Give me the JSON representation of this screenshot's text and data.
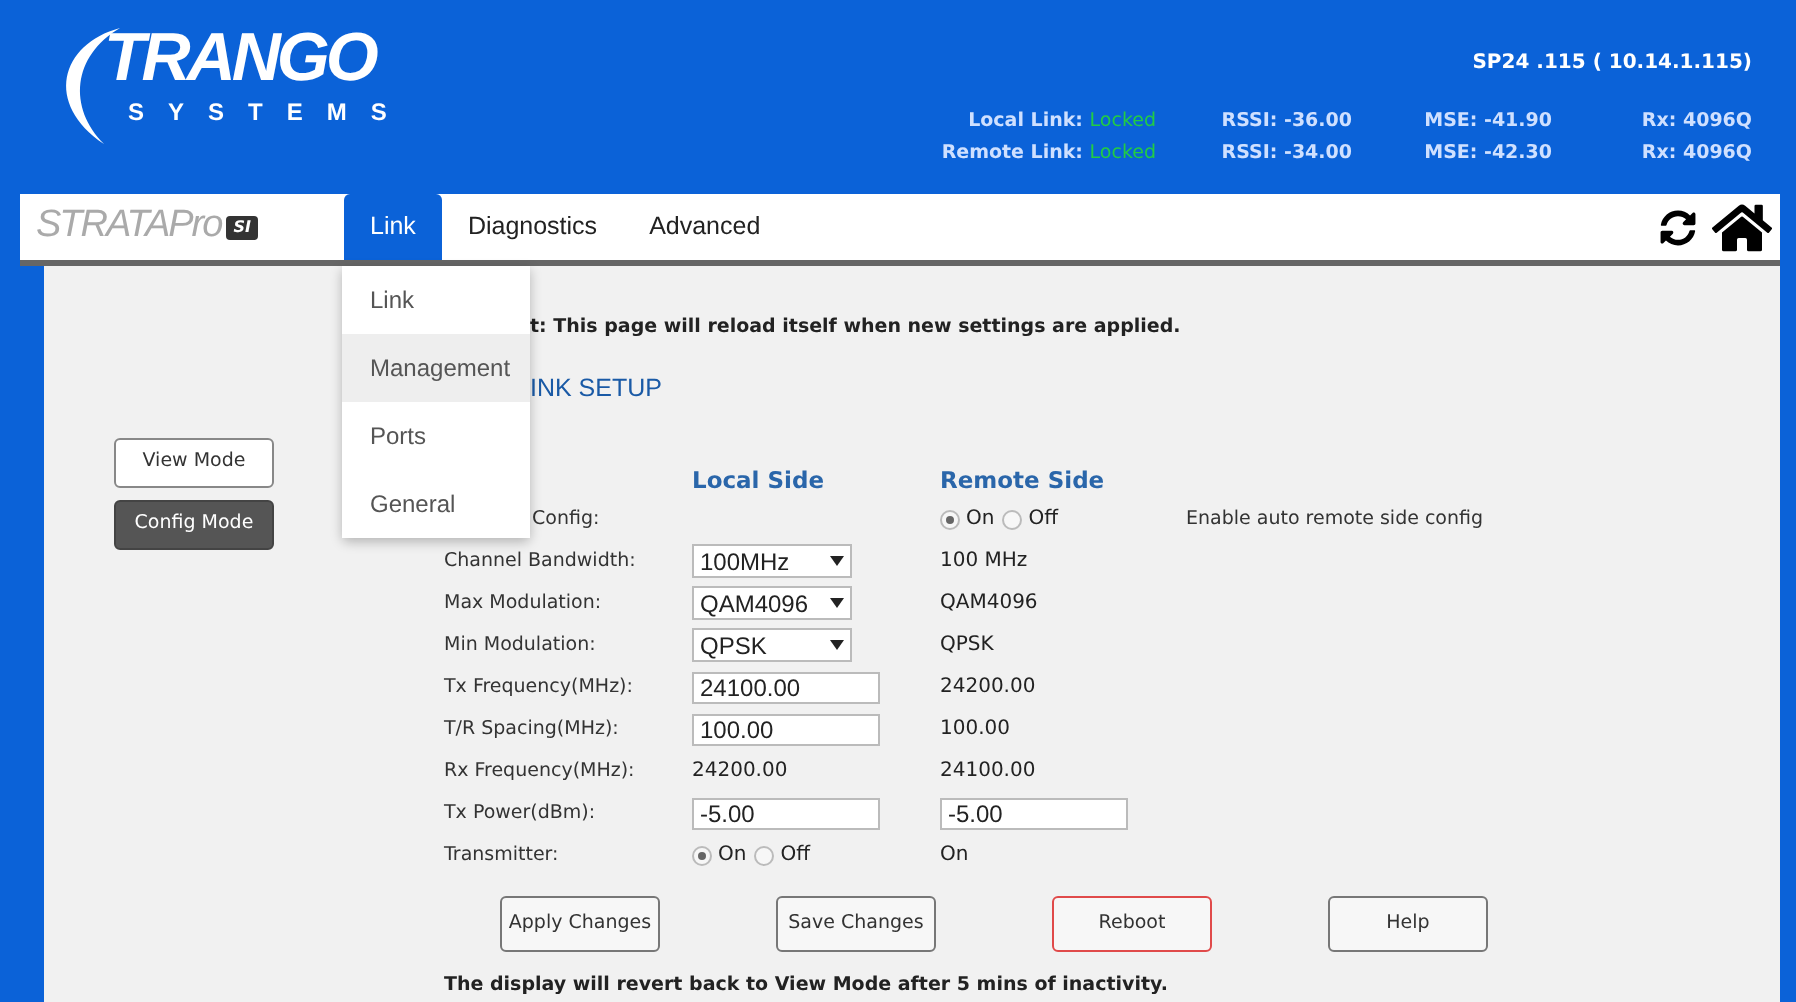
{
  "logo": {
    "name": "TRANGO",
    "tagline": "SYSTEMS"
  },
  "device": "SP24 .115 ( 10.14.1.115)",
  "links": [
    {
      "label": "Local Link:",
      "state": "Locked",
      "rssi": "RSSI: -36.00",
      "mse": "MSE: -41.90",
      "rx": "Rx: 4096Q"
    },
    {
      "label": "Remote Link:",
      "state": "Locked",
      "rssi": "RSSI: -34.00",
      "mse": "MSE: -42.30",
      "rx": "Rx: 4096Q"
    }
  ],
  "brand": {
    "name": "STRATAPro",
    "badge": "SI"
  },
  "tabs": [
    {
      "label": "Link",
      "selected": true
    },
    {
      "label": "Diagnostics",
      "selected": false
    },
    {
      "label": "Advanced",
      "selected": false
    }
  ],
  "menu": [
    {
      "label": "Link",
      "highlighted": false
    },
    {
      "label": "Management",
      "highlighted": true
    },
    {
      "label": "Ports",
      "highlighted": false
    },
    {
      "label": "General",
      "highlighted": false
    }
  ],
  "modes": [
    {
      "label": "View Mode",
      "selected": false
    },
    {
      "label": "Config Mode",
      "selected": true
    }
  ],
  "notice": "t: This page will reload itself when new settings are applied.",
  "section_title": "INK SETUP",
  "columns": [
    "Local Side",
    "Remote Side"
  ],
  "rows": [
    {
      "label": "Config:",
      "local": {
        "kind": "none"
      },
      "remote": {
        "kind": "radio",
        "options": [
          {
            "label": "On",
            "selected": true
          },
          {
            "label": "Off",
            "selected": false
          }
        ]
      },
      "note": "Enable auto remote side config"
    },
    {
      "label": "Channel Bandwidth:",
      "local": {
        "kind": "select",
        "value": "100MHz"
      },
      "remote": {
        "kind": "text",
        "value": "100 MHz"
      }
    },
    {
      "label": "Max Modulation:",
      "local": {
        "kind": "select",
        "value": "QAM4096"
      },
      "remote": {
        "kind": "text",
        "value": "QAM4096"
      }
    },
    {
      "label": "Min Modulation:",
      "local": {
        "kind": "select",
        "value": "QPSK"
      },
      "remote": {
        "kind": "text",
        "value": "QPSK"
      }
    },
    {
      "label": "Tx Frequency(MHz):",
      "local": {
        "kind": "input",
        "value": "24100.00"
      },
      "remote": {
        "kind": "text",
        "value": "24200.00"
      }
    },
    {
      "label": "T/R Spacing(MHz):",
      "local": {
        "kind": "input",
        "value": "100.00"
      },
      "remote": {
        "kind": "text",
        "value": "100.00"
      }
    },
    {
      "label": "Rx Frequency(MHz):",
      "local": {
        "kind": "text",
        "value": "24200.00"
      },
      "remote": {
        "kind": "text",
        "value": "24100.00"
      }
    },
    {
      "label": "Tx Power(dBm):",
      "local": {
        "kind": "input",
        "value": "-5.00"
      },
      "remote": {
        "kind": "input",
        "value": "-5.00"
      }
    },
    {
      "label": "Transmitter:",
      "local": {
        "kind": "radio",
        "options": [
          {
            "label": "On",
            "selected": true
          },
          {
            "label": "Off",
            "selected": false
          }
        ]
      },
      "remote": {
        "kind": "text",
        "value": "On"
      }
    }
  ],
  "buttons": [
    {
      "label": "Apply Changes",
      "kind": "normal"
    },
    {
      "label": "Save Changes",
      "kind": "normal"
    },
    {
      "label": "Reboot",
      "kind": "danger"
    },
    {
      "label": "Help",
      "kind": "normal"
    }
  ],
  "footer": "The display will revert back to View Mode after 5 mins of inactivity."
}
